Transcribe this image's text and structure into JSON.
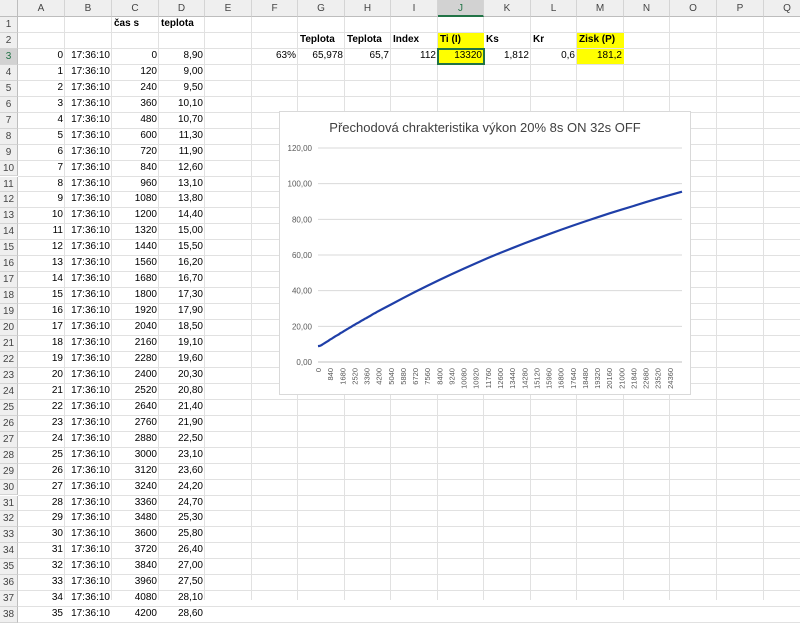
{
  "columns": [
    "A",
    "B",
    "C",
    "D",
    "E",
    "F",
    "G",
    "H",
    "I",
    "J",
    "K",
    "L",
    "M",
    "N",
    "O",
    "P",
    "Q"
  ],
  "active_column": "J",
  "active_row": 3,
  "headers_row1": {
    "C": "čas s",
    "D": "teplota"
  },
  "params_row2": {
    "G": "Teplota",
    "H": "Teplota",
    "I": "Index",
    "J": "Ti (I)",
    "K": "Ks",
    "L": "Kr",
    "M": "Zisk (P)"
  },
  "params_row3": {
    "F": "63%",
    "G": "65,978",
    "H": "65,7",
    "I": "112",
    "J": "13320",
    "K": "1,812",
    "L": "0,6",
    "M": "181,2"
  },
  "rows": [
    {
      "row": 3,
      "a": "0",
      "b": "17:36:10",
      "c": "0",
      "d": "8,90"
    },
    {
      "row": 4,
      "a": "1",
      "b": "17:36:10",
      "c": "120",
      "d": "9,00"
    },
    {
      "row": 5,
      "a": "2",
      "b": "17:36:10",
      "c": "240",
      "d": "9,50"
    },
    {
      "row": 6,
      "a": "3",
      "b": "17:36:10",
      "c": "360",
      "d": "10,10"
    },
    {
      "row": 7,
      "a": "4",
      "b": "17:36:10",
      "c": "480",
      "d": "10,70"
    },
    {
      "row": 8,
      "a": "5",
      "b": "17:36:10",
      "c": "600",
      "d": "11,30"
    },
    {
      "row": 9,
      "a": "6",
      "b": "17:36:10",
      "c": "720",
      "d": "11,90"
    },
    {
      "row": 10,
      "a": "7",
      "b": "17:36:10",
      "c": "840",
      "d": "12,60"
    },
    {
      "row": 11,
      "a": "8",
      "b": "17:36:10",
      "c": "960",
      "d": "13,10"
    },
    {
      "row": 12,
      "a": "9",
      "b": "17:36:10",
      "c": "1080",
      "d": "13,80"
    },
    {
      "row": 13,
      "a": "10",
      "b": "17:36:10",
      "c": "1200",
      "d": "14,40"
    },
    {
      "row": 14,
      "a": "11",
      "b": "17:36:10",
      "c": "1320",
      "d": "15,00"
    },
    {
      "row": 15,
      "a": "12",
      "b": "17:36:10",
      "c": "1440",
      "d": "15,50"
    },
    {
      "row": 16,
      "a": "13",
      "b": "17:36:10",
      "c": "1560",
      "d": "16,20"
    },
    {
      "row": 17,
      "a": "14",
      "b": "17:36:10",
      "c": "1680",
      "d": "16,70"
    },
    {
      "row": 18,
      "a": "15",
      "b": "17:36:10",
      "c": "1800",
      "d": "17,30"
    },
    {
      "row": 19,
      "a": "16",
      "b": "17:36:10",
      "c": "1920",
      "d": "17,90"
    },
    {
      "row": 20,
      "a": "17",
      "b": "17:36:10",
      "c": "2040",
      "d": "18,50"
    },
    {
      "row": 21,
      "a": "18",
      "b": "17:36:10",
      "c": "2160",
      "d": "19,10"
    },
    {
      "row": 22,
      "a": "19",
      "b": "17:36:10",
      "c": "2280",
      "d": "19,60"
    },
    {
      "row": 23,
      "a": "20",
      "b": "17:36:10",
      "c": "2400",
      "d": "20,30"
    },
    {
      "row": 24,
      "a": "21",
      "b": "17:36:10",
      "c": "2520",
      "d": "20,80"
    },
    {
      "row": 25,
      "a": "22",
      "b": "17:36:10",
      "c": "2640",
      "d": "21,40"
    },
    {
      "row": 26,
      "a": "23",
      "b": "17:36:10",
      "c": "2760",
      "d": "21,90"
    },
    {
      "row": 27,
      "a": "24",
      "b": "17:36:10",
      "c": "2880",
      "d": "22,50"
    },
    {
      "row": 28,
      "a": "25",
      "b": "17:36:10",
      "c": "3000",
      "d": "23,10"
    },
    {
      "row": 29,
      "a": "26",
      "b": "17:36:10",
      "c": "3120",
      "d": "23,60"
    },
    {
      "row": 30,
      "a": "27",
      "b": "17:36:10",
      "c": "3240",
      "d": "24,20"
    },
    {
      "row": 31,
      "a": "28",
      "b": "17:36:10",
      "c": "3360",
      "d": "24,70"
    },
    {
      "row": 32,
      "a": "29",
      "b": "17:36:10",
      "c": "3480",
      "d": "25,30"
    },
    {
      "row": 33,
      "a": "30",
      "b": "17:36:10",
      "c": "3600",
      "d": "25,80"
    },
    {
      "row": 34,
      "a": "31",
      "b": "17:36:10",
      "c": "3720",
      "d": "26,40"
    },
    {
      "row": 35,
      "a": "32",
      "b": "17:36:10",
      "c": "3840",
      "d": "27,00"
    },
    {
      "row": 36,
      "a": "33",
      "b": "17:36:10",
      "c": "3960",
      "d": "27,50"
    },
    {
      "row": 37,
      "a": "34",
      "b": "17:36:10",
      "c": "4080",
      "d": "28,10"
    },
    {
      "row": 38,
      "a": "35",
      "b": "17:36:10",
      "c": "4200",
      "d": "28,60"
    }
  ],
  "colors": {
    "highlight": "#ffff00",
    "series": "#1f3fa8",
    "accent": "#217346"
  },
  "chart_data": {
    "type": "line",
    "title": "Přechodová chrakteristika výkon 20% 8s ON 32s OFF",
    "xlabel": "",
    "ylabel": "",
    "ylim": [
      0,
      120
    ],
    "y_ticks": [
      "0,00",
      "20,00",
      "40,00",
      "60,00",
      "80,00",
      "100,00",
      "120,00"
    ],
    "x_tick_labels": [
      "0",
      "840",
      "1680",
      "2520",
      "3360",
      "4200",
      "5040",
      "5880",
      "6720",
      "7560",
      "8400",
      "9240",
      "10080",
      "10920",
      "11760",
      "12600",
      "13440",
      "14280",
      "15120",
      "15960",
      "16800",
      "17640",
      "18480",
      "19320",
      "20160",
      "21000",
      "21840",
      "22680",
      "23520",
      "24360"
    ],
    "xlim": [
      0,
      25200
    ],
    "grid": true,
    "series": [
      {
        "x": [
          0,
          120,
          240,
          360,
          480,
          600,
          720,
          840,
          960,
          1080,
          1200,
          1320,
          1440,
          1560,
          1680,
          1800,
          1920,
          2040,
          2160,
          2280,
          2400,
          2520,
          2640,
          2760,
          2880,
          3000,
          3120,
          3240,
          3360,
          3480,
          3600,
          3720,
          3840,
          3960,
          4080,
          4200,
          5040,
          5880,
          6720,
          7560,
          8400,
          9240,
          10080,
          10920,
          11760,
          12600,
          13440,
          14280,
          15120,
          15960,
          16800,
          17640,
          18480,
          19320,
          20160,
          21000,
          21840,
          22680,
          23520,
          24360,
          25200
        ],
        "values": [
          8.9,
          9.0,
          9.5,
          10.1,
          10.7,
          11.3,
          11.9,
          12.6,
          13.1,
          13.8,
          14.4,
          15.0,
          15.5,
          16.2,
          16.7,
          17.3,
          17.9,
          18.5,
          19.1,
          19.6,
          20.3,
          20.8,
          21.4,
          21.9,
          22.5,
          23.1,
          23.6,
          24.2,
          24.7,
          25.3,
          25.8,
          26.4,
          27.0,
          27.5,
          28.1,
          28.6,
          32.2,
          35.8,
          39.3,
          42.7,
          46.0,
          49.2,
          52.3,
          55.3,
          58.3,
          61.1,
          63.8,
          66.5,
          69.1,
          71.6,
          74.1,
          76.5,
          78.8,
          81.1,
          83.3,
          85.4,
          87.5,
          89.6,
          91.6,
          93.6,
          95.5
        ]
      }
    ]
  }
}
